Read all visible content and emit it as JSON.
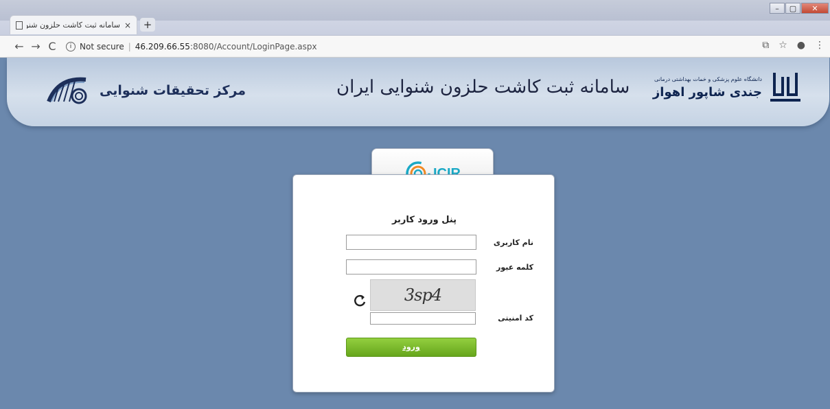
{
  "browser": {
    "tab_title": "سامانه ثبت کاشت حلزون شنوایی ایران",
    "tab_close": "×",
    "new_tab": "+",
    "security_label": "Not secure",
    "url_host": "46.209.66.55",
    "url_rest": ":8080/Account/LoginPage.aspx",
    "window_buttons": {
      "minimize": "–",
      "maximize": "▢",
      "close": "✕"
    }
  },
  "header": {
    "left_name": "مرکز تحقیقات شنوایی",
    "center_title": "سامانه ثبت کاشت حلزون شنوایی ایران",
    "right_subtitle": "دانشگاه علوم پزشکی و خمات بهداشتی درمانی",
    "right_name": "جندی شاپور اهواز"
  },
  "login": {
    "logo_text": "ICIR",
    "panel_title": "پنل ورود کاربر",
    "username_label": "نام کاربری",
    "username_value": "",
    "password_label": "کلمه عبور",
    "password_value": "",
    "captcha_label": "کد امنیتی",
    "captcha_text": "3sp4",
    "captcha_value": "",
    "submit_label": "ورود"
  },
  "colors": {
    "page_bg": "#6b88ad",
    "header_bg": "#c5d3e4",
    "button_green": "#7aba2a",
    "logo_teal": "#1aa9c6"
  }
}
